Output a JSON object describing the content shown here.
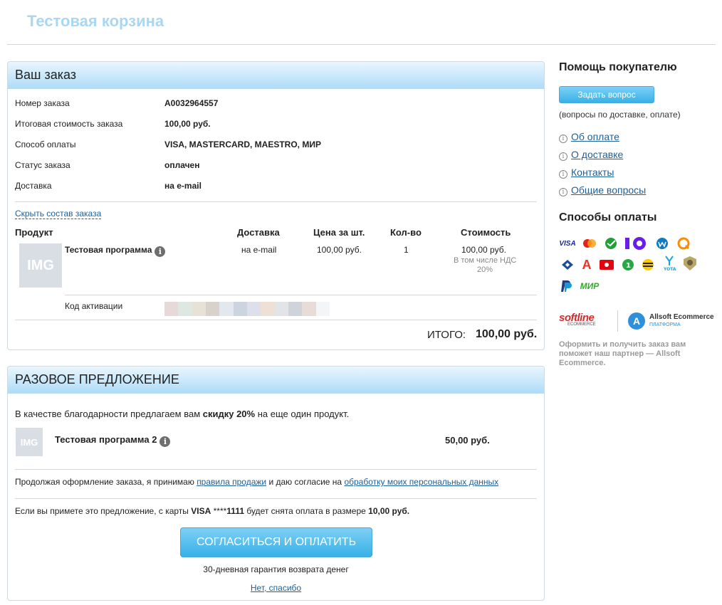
{
  "site": {
    "title": "Тестовая корзина"
  },
  "order": {
    "heading": "Ваш заказ",
    "rows": [
      {
        "label": "Номер заказа",
        "value": "A0032964557"
      },
      {
        "label": "Итоговая стоимость заказа",
        "value": "100,00 руб."
      },
      {
        "label": "Способ оплаты",
        "value": "VISA, MASTERCARD, MAESTRO, МИР"
      },
      {
        "label": "Статус заказа",
        "value": "оплачен"
      },
      {
        "label": "Доставка",
        "value": "на e-mail"
      }
    ],
    "toggle_link": "Скрыть состав заказа",
    "table_headers": {
      "product": "Продукт",
      "delivery": "Доставка",
      "price": "Цена за шт.",
      "qty": "Кол-во",
      "cost": "Стоимость"
    },
    "item": {
      "image_text": "IMG",
      "name": "Тестовая программа",
      "delivery": "на e-mail",
      "price": "100,00 руб.",
      "qty": "1",
      "cost": "100,00 руб.",
      "vat_note_line1": "В том числе НДС",
      "vat_note_line2": "20%"
    },
    "activation_label": "Код активации",
    "total_label": "ИТОГО:",
    "total_value": "100,00 руб."
  },
  "offer": {
    "heading": "РАЗОВОЕ ПРЕДЛОЖЕНИЕ",
    "intro_before": "В качестве благодарности предлагаем вам ",
    "intro_bold": "скидку 20%",
    "intro_after": " на еще один продукт.",
    "product_image_text": "IMG",
    "product_name": "Тестовая программа 2",
    "product_price": "50,00 руб.",
    "consent_before": "Продолжая оформление заказа, я принимаю ",
    "consent_link1": "правила продажи",
    "consent_middle": " и даю согласие на ",
    "consent_link2": "обработку моих персональных данных",
    "charge_before": "Если вы примете это предложение, с карты ",
    "charge_card": "VISA",
    "charge_mask": " ****",
    "charge_last4": "1111",
    "charge_mid": " будет снята оплата в размере ",
    "charge_amount": "10,00 руб.",
    "cta_label": "СОГЛАСИТЬСЯ И ОПЛАТИТЬ",
    "guarantee": "30-дневная гарантия возврата денег",
    "decline_link": "Нет, спасибо"
  },
  "sidebar": {
    "help_heading": "Помощь покупателю",
    "ask_button": "Задать вопрос",
    "ask_note": "(вопросы по доставке, оплате)",
    "links": [
      "Об оплате",
      "О доставке",
      "Контакты",
      "Общие вопросы"
    ],
    "payments_heading": "Способы оплаты",
    "payment_icons": [
      "VISA",
      "mastercard-icon",
      "sberbank-icon",
      "yoomoney-icon",
      "webmoney-icon",
      "qiwi-icon",
      "alfa-icon",
      "mts-icon",
      "beeline-icon",
      "tinkoff-icon",
      "yota-icon",
      "paypal-icon",
      "МИР"
    ],
    "partner_logo_1": "softline",
    "partner_logo_1_sub": "ECOMMERCE",
    "partner_logo_2": "Allsoft Ecommerce",
    "partner_logo_2_sub": "ПЛАТФОРМА",
    "partner_note": "Оформить и получить заказ вам поможет наш партнер — Allsoft Ecommerce."
  }
}
